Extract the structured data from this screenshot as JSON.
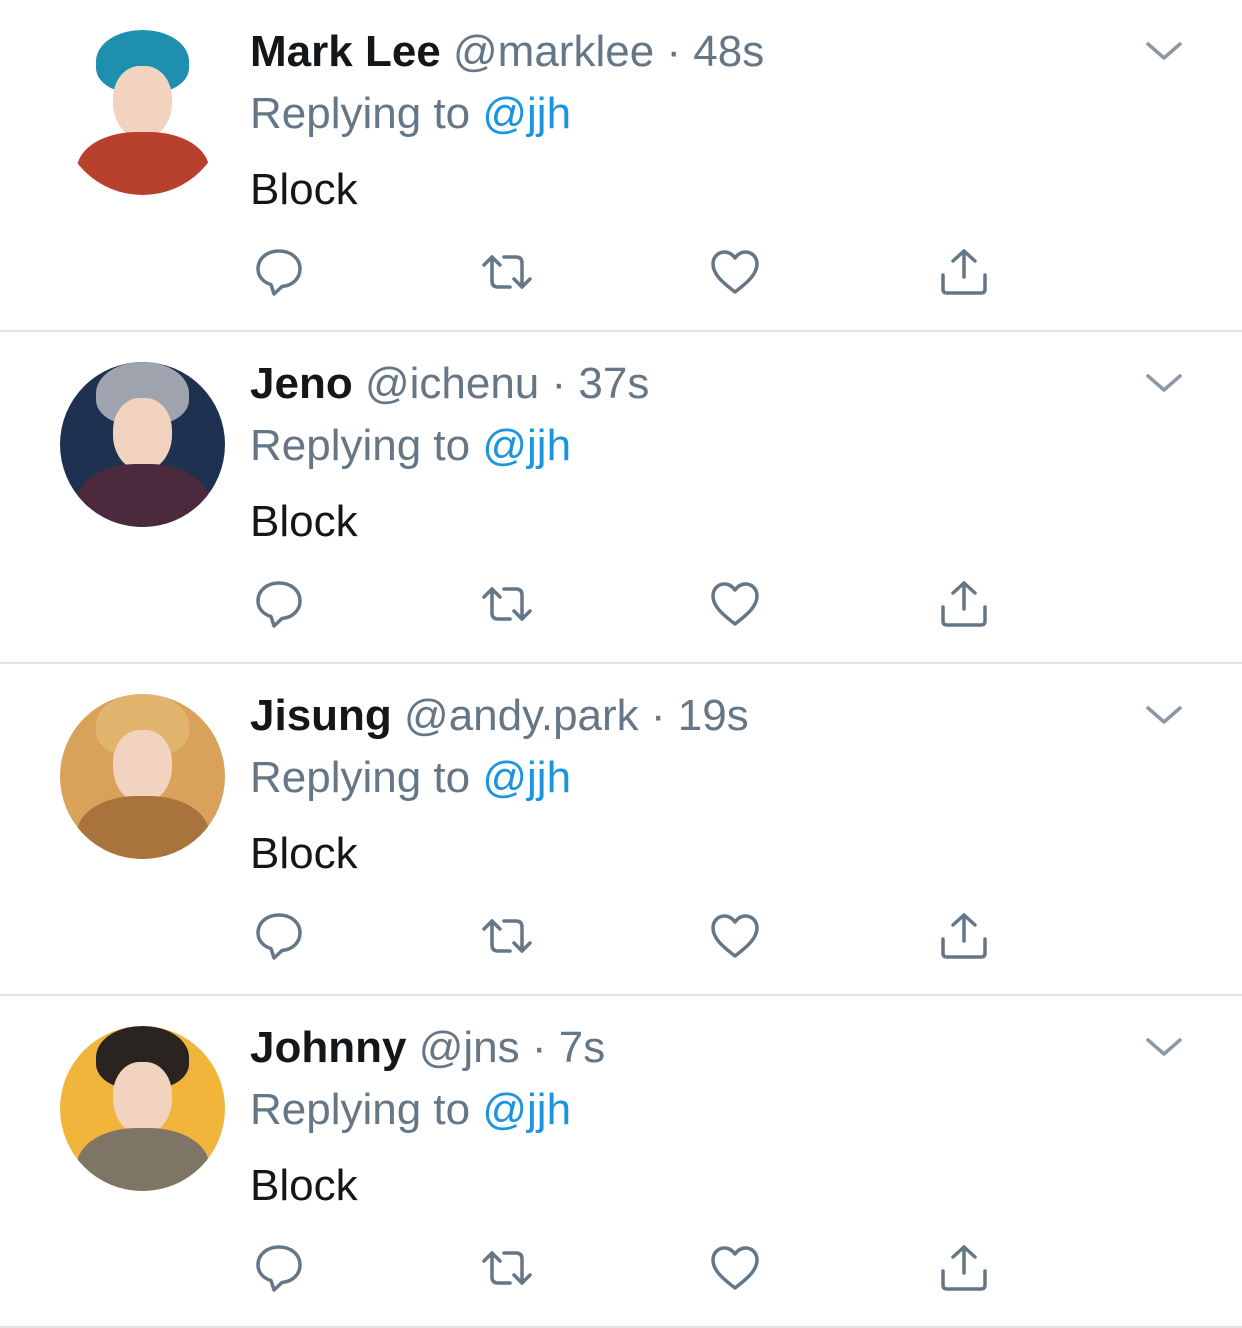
{
  "tweets": [
    {
      "name": "Mark Lee",
      "handle": "@marklee",
      "dot": "·",
      "time": "48s",
      "replying_prefix": "Replying to ",
      "replying_to": "@jjh",
      "text": "Block",
      "avatar_colors": {
        "bg": "#ffffff",
        "hair": "#1f8fb0",
        "body": "#b7412c"
      }
    },
    {
      "name": "Jeno",
      "handle": "@ichenu",
      "dot": "·",
      "time": "37s",
      "replying_prefix": "Replying to ",
      "replying_to": "@jjh",
      "text": "Block",
      "avatar_colors": {
        "bg": "#1f3150",
        "hair": "#9ea3ad",
        "body": "#4a2a3c"
      }
    },
    {
      "name": "Jisung",
      "handle": "@andy.park",
      "dot": "·",
      "time": "19s",
      "replying_prefix": "Replying to ",
      "replying_to": "@jjh",
      "text": "Block",
      "avatar_colors": {
        "bg": "#d9a25a",
        "hair": "#e2b56e",
        "body": "#a8743c"
      }
    },
    {
      "name": "Johnny",
      "handle": "@jns",
      "dot": "·",
      "time": "7s",
      "replying_prefix": "Replying to ",
      "replying_to": "@jjh",
      "text": "Block",
      "avatar_colors": {
        "bg": "#f0b53a",
        "hair": "#2a2420",
        "body": "#7f7566"
      }
    }
  ],
  "icons": {
    "reply": "reply-icon",
    "retweet": "retweet-icon",
    "like": "heart-icon",
    "share": "share-icon",
    "more": "chevron-down-icon"
  },
  "colors": {
    "text": "#14171a",
    "secondary": "#657786",
    "mention": "#1b95e0",
    "divider": "#dfe3e6"
  }
}
